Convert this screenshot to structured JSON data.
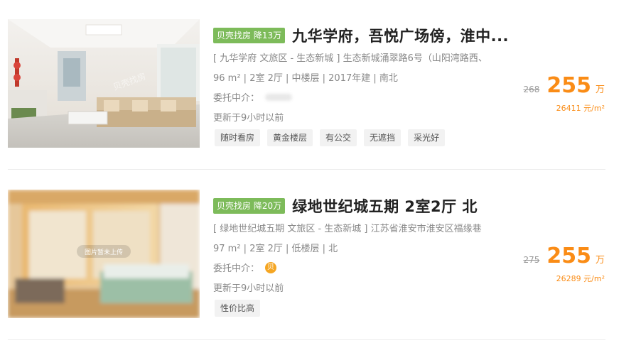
{
  "listings": [
    {
      "promo_badge": "贝壳找房 降13万",
      "title": "九华学府，吾悦广场傍，淮中...",
      "address": "[ 九华学府 文旅区 - 生态新城 ] 生态新城涌翠路6号（山阳湾路西、",
      "specs": "96 m² | 2室 2厅 | 中楼层 | 2017年建 | 南北",
      "agent_label": "委托中介：",
      "updated": "更新于9小时以前",
      "tags": [
        "随时看房",
        "黄金楼层",
        "有公交",
        "无遮挡",
        "采光好"
      ],
      "old_price": "268",
      "total_price": "255",
      "total_unit": "万",
      "unit_price": "26411 元/m²"
    },
    {
      "promo_badge": "贝壳找房 降20万",
      "title": "绿地世纪城五期 2室2厅 北",
      "address": "[ 绿地世纪城五期 文旅区 - 生态新城 ] 江苏省淮安市淮安区福缘巷",
      "specs": "97 m² | 2室 2厅 | 低楼层 | 北",
      "agent_label": "委托中介：",
      "agent_badge": "贝",
      "updated": "更新于9小时以前",
      "tags": [
        "性价比高"
      ],
      "photo_placeholder": "图片暂未上传",
      "old_price": "275",
      "total_price": "255",
      "total_unit": "万",
      "unit_price": "26289 元/m²"
    }
  ],
  "watermark": "贝壳找房",
  "colors": {
    "promo_bg": "#7dbb5a",
    "price": "#fa8c16",
    "tag_bg": "#f2f2f2",
    "agent_badge": "#f5a623"
  }
}
